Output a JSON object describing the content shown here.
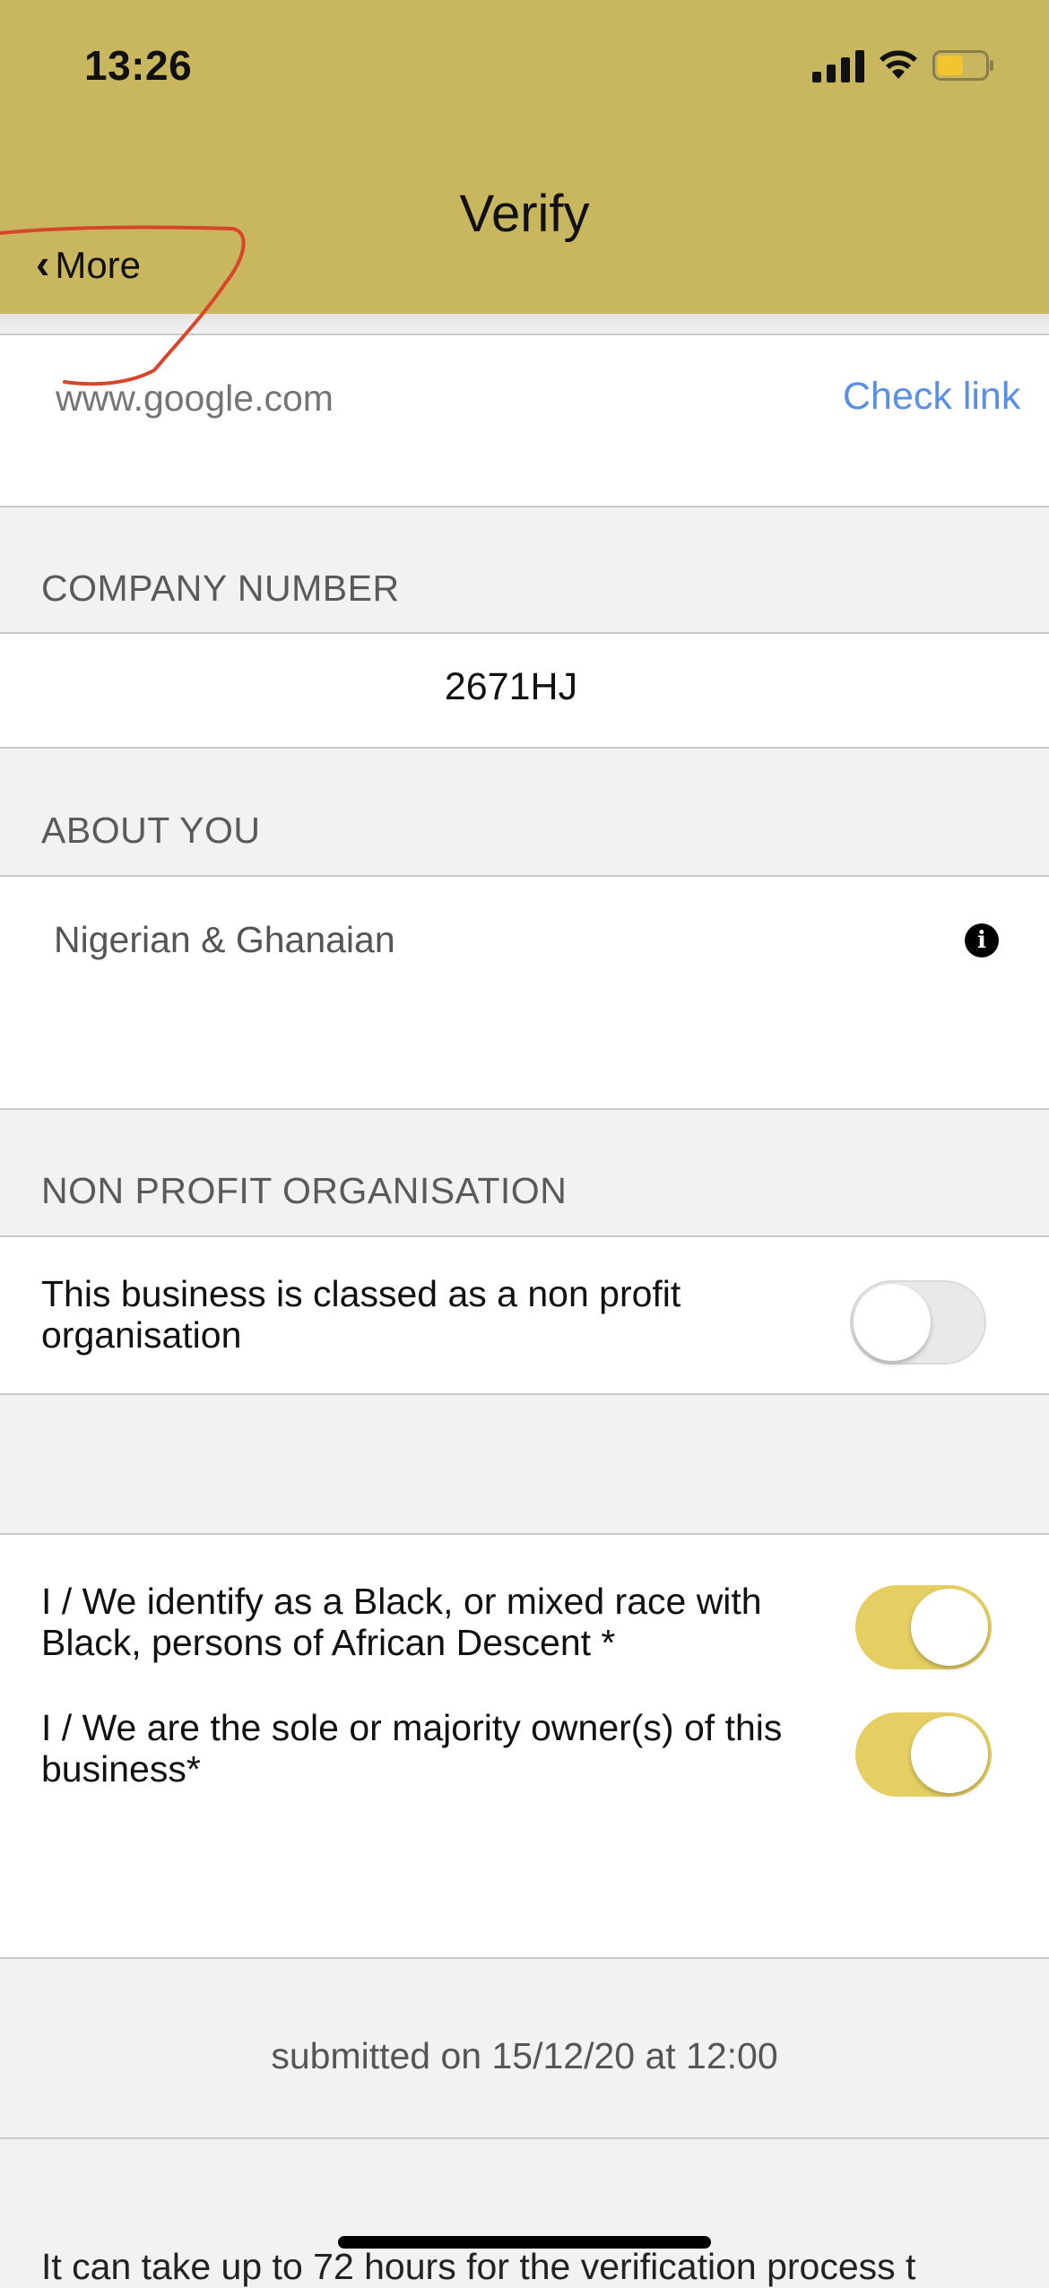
{
  "status_bar": {
    "time": "13:26"
  },
  "nav": {
    "title": "Verify",
    "back_label": "More"
  },
  "website": {
    "placeholder": "www.google.com",
    "check_link_label": "Check link"
  },
  "company": {
    "section_title": "COMPANY NUMBER",
    "value": "2671HJ"
  },
  "about": {
    "section_title": "ABOUT YOU",
    "text": "Nigerian & Ghanaian",
    "info_glyph": "i"
  },
  "non_profit": {
    "section_title": "NON PROFIT ORGANISATION",
    "label": "This business is classed as a non profit organisation",
    "enabled": false
  },
  "identity": {
    "black_label": "I / We identify as a Black, or mixed race with Black, persons of African Descent *",
    "black_enabled": true,
    "owner_label": "I / We are the sole or majority owner(s) of this business*",
    "owner_enabled": true
  },
  "submission": {
    "text": "submitted on 15/12/20 at 12:00"
  },
  "footer": {
    "note": "It can take up to 72 hours for the verification process t"
  },
  "colors": {
    "header": "#c9b760",
    "link": "#5a8fe6",
    "toggle_on": "#e6cf62",
    "annotation": "#d9452b"
  }
}
